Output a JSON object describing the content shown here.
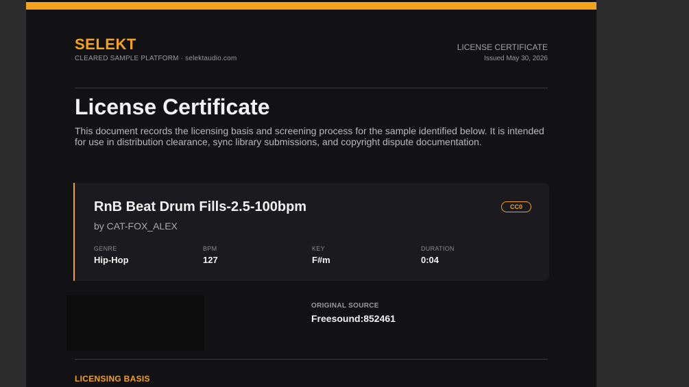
{
  "header": {
    "brand": "SELEKT",
    "brand_subtitle": "CLEARED SAMPLE PLATFORM · selektaudio.com",
    "doc_label": "LICENSE CERTIFICATE",
    "issued": "Issued May 30, 2026"
  },
  "intro": {
    "title": "License Certificate",
    "description": "This document records the licensing basis and screening process for the sample identified below. It is intended for use in distribution clearance, sync library submissions, and copyright dispute documentation."
  },
  "sample": {
    "title": "RnB Beat Drum Fills-2.5-100bpm",
    "artist": "by CAT-FOX_ALEX",
    "license_badge": "CC0",
    "meta": [
      {
        "label": "GENRE",
        "value": "Hip-Hop"
      },
      {
        "label": "BPM",
        "value": "127"
      },
      {
        "label": "KEY",
        "value": "F#m"
      },
      {
        "label": "DURATION",
        "value": "0:04"
      }
    ]
  },
  "source": {
    "label": "ORIGINAL SOURCE",
    "value": "Freesound:852461"
  },
  "sections": {
    "licensing_basis": "LICENSING BASIS"
  },
  "colors": {
    "accent": "#f5a31a",
    "page_background": "#121215",
    "card_background": "#1b1b1f"
  }
}
